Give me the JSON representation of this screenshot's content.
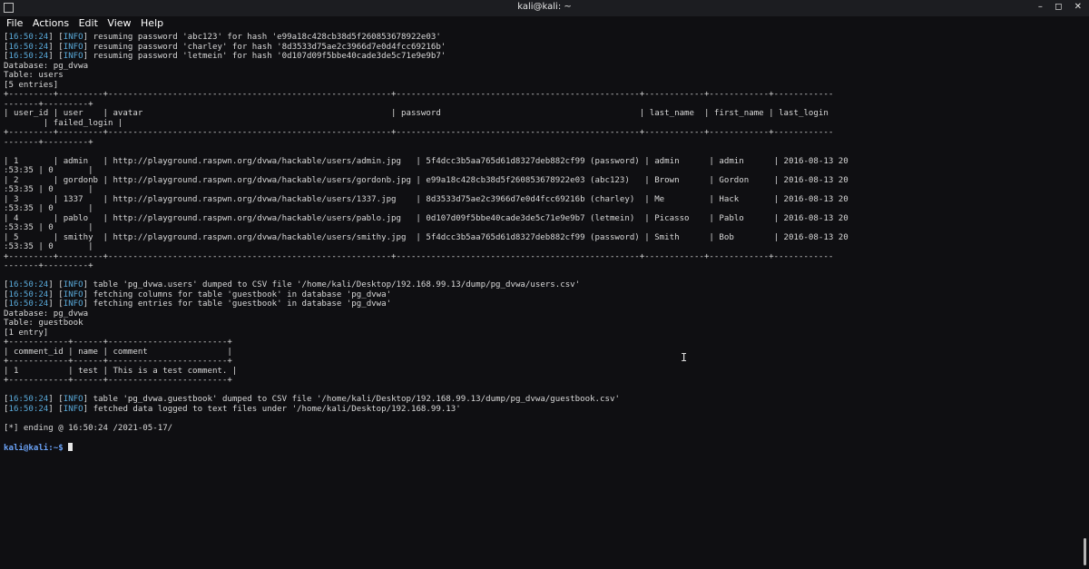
{
  "window": {
    "title": "kali@kali: ~",
    "controls": [
      "–",
      "◻",
      "✕"
    ]
  },
  "menu": [
    "File",
    "Actions",
    "Edit",
    "View",
    "Help"
  ],
  "terminal": {
    "lines": [
      "[16:50:24] [INFO] resuming password 'abc123' for hash 'e99a18c428cb38d5f260853678922e03'",
      "[16:50:24] [INFO] resuming password 'charley' for hash '8d3533d75ae2c3966d7e0d4fcc69216b'",
      "[16:50:24] [INFO] resuming password 'letmein' for hash '0d107d09f5bbe40cade3de5c71e9e9b7'",
      "Database: pg_dvwa",
      "Table: users",
      "[5 entries]",
      "+---------+---------+---------------------------------------------------------+-------------------------------------------------+------------+------------+------------",
      "-------+---------+",
      "| user_id | user    | avatar                                                  | password                                        | last_name  | first_name | last_login",
      "        | failed_login |",
      "+---------+---------+---------------------------------------------------------+-------------------------------------------------+------------+------------+------------",
      "-------+---------+",
      "",
      "| 1       | admin   | http://playground.raspwn.org/dvwa/hackable/users/admin.jpg   | 5f4dcc3b5aa765d61d8327deb882cf99 (password) | admin      | admin      | 2016-08-13 20",
      ":53:35 | 0       |",
      "| 2       | gordonb | http://playground.raspwn.org/dvwa/hackable/users/gordonb.jpg | e99a18c428cb38d5f260853678922e03 (abc123)   | Brown      | Gordon     | 2016-08-13 20",
      ":53:35 | 0       |",
      "| 3       | 1337    | http://playground.raspwn.org/dvwa/hackable/users/1337.jpg    | 8d3533d75ae2c3966d7e0d4fcc69216b (charley)  | Me         | Hack       | 2016-08-13 20",
      ":53:35 | 0       |",
      "| 4       | pablo   | http://playground.raspwn.org/dvwa/hackable/users/pablo.jpg   | 0d107d09f5bbe40cade3de5c71e9e9b7 (letmein)  | Picasso    | Pablo      | 2016-08-13 20",
      ":53:35 | 0       |",
      "| 5       | smithy  | http://playground.raspwn.org/dvwa/hackable/users/smithy.jpg  | 5f4dcc3b5aa765d61d8327deb882cf99 (password) | Smith      | Bob        | 2016-08-13 20",
      ":53:35 | 0       |",
      "+---------+---------+---------------------------------------------------------+-------------------------------------------------+------------+------------+------------",
      "-------+---------+",
      "",
      "[16:50:24] [INFO] table 'pg_dvwa.users' dumped to CSV file '/home/kali/Desktop/192.168.99.13/dump/pg_dvwa/users.csv'",
      "[16:50:24] [INFO] fetching columns for table 'guestbook' in database 'pg_dvwa'",
      "[16:50:24] [INFO] fetching entries for table 'guestbook' in database 'pg_dvwa'",
      "Database: pg_dvwa",
      "Table: guestbook",
      "[1 entry]",
      "+------------+------+------------------------+",
      "| comment_id | name | comment                |",
      "+------------+------+------------------------+",
      "| 1          | test | This is a test comment. |",
      "+------------+------+------------------------+",
      "",
      "[16:50:24] [INFO] table 'pg_dvwa.guestbook' dumped to CSV file '/home/kali/Desktop/192.168.99.13/dump/pg_dvwa/guestbook.csv'",
      "[16:50:24] [INFO] fetched data logged to text files under '/home/kali/Desktop/192.168.99.13'",
      "",
      "[*] ending @ 16:50:24 /2021-05-17/",
      ""
    ],
    "prompt": "kali@kali",
    "prompt_suffix": ":~$ "
  }
}
